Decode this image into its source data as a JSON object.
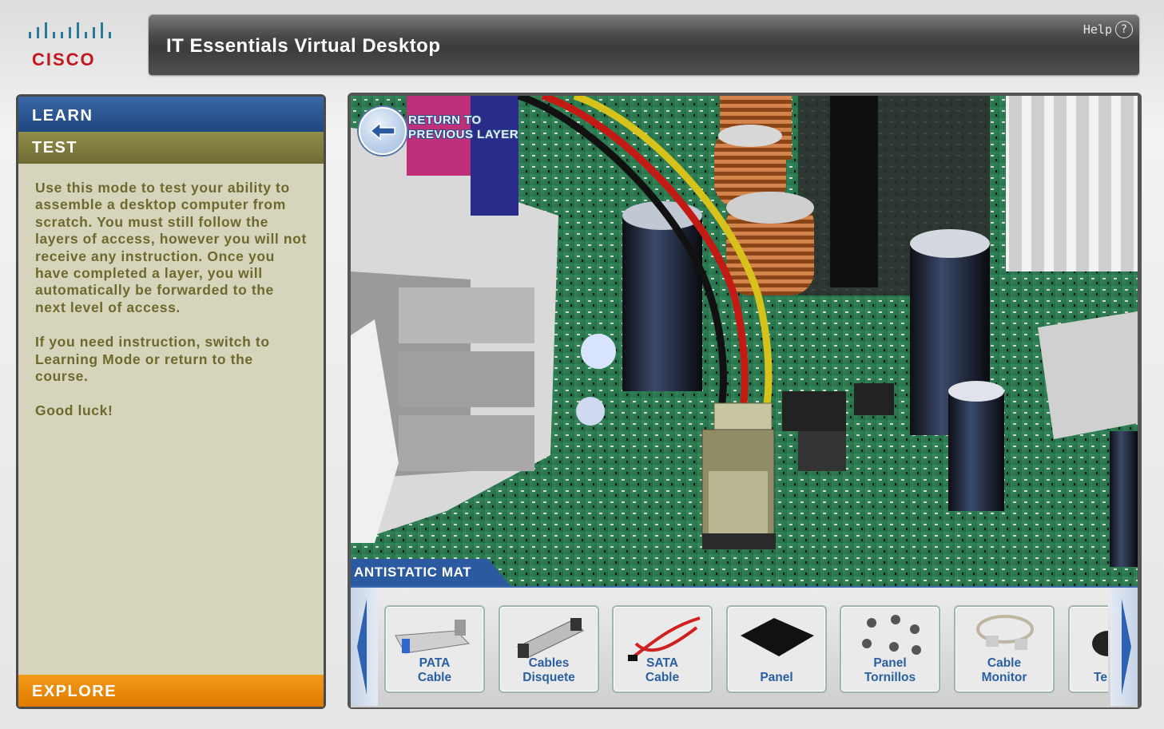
{
  "logo": {
    "text": "CISCO"
  },
  "header": {
    "title": "IT Essentials Virtual Desktop",
    "help_label": "Help",
    "help_icon": "?"
  },
  "left_panel": {
    "tab_learn": "LEARN",
    "tab_test": "TEST",
    "tab_explore": "EXPLORE",
    "description": [
      "Use this mode to test your ability to assemble a desktop computer from scratch. You must still follow the layers of access, however you will not receive any instruction. Once you have completed a layer, you will automatically be forwarded to the next level of access.",
      "If you need instruction, switch to Learning Mode or return to the course.",
      "Good luck!"
    ]
  },
  "viewport": {
    "return_line1": "RETURN TO",
    "return_line2": "PREVIOUS LAYER",
    "location_label": "ANTISTATIC MAT"
  },
  "tray": {
    "items": [
      {
        "line1": "PATA",
        "line2": "Cable",
        "icon": "pata-cable-icon"
      },
      {
        "line1": "Cables",
        "line2": "Disquete",
        "icon": "floppy-cable-icon"
      },
      {
        "line1": "SATA",
        "line2": "Cable",
        "icon": "sata-cable-icon"
      },
      {
        "line1": "",
        "line2": "Panel",
        "icon": "panel-icon"
      },
      {
        "line1": "Panel",
        "line2": "Tornillos",
        "icon": "screws-icon"
      },
      {
        "line1": "Cable",
        "line2": "Monitor",
        "icon": "monitor-cable-icon"
      },
      {
        "line1": "",
        "line2": "Te",
        "icon": "keyboard-icon"
      }
    ]
  },
  "colors": {
    "learn": "#1f4680",
    "test": "#7a7834",
    "explore": "#e98800",
    "accent_blue": "#2b5fa3"
  }
}
